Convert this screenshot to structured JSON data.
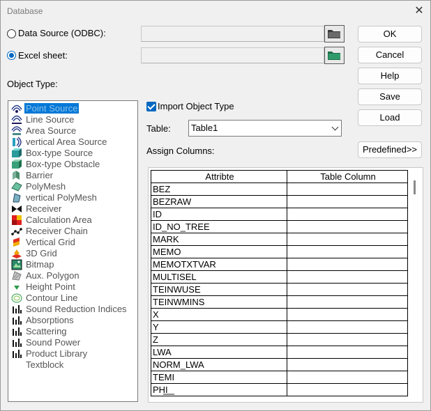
{
  "window": {
    "title": "Database"
  },
  "source": {
    "odbc_label": "Data Source (ODBC):",
    "odbc_selected": false,
    "excel_label": "Excel sheet:",
    "excel_selected": true,
    "odbc_value": "",
    "excel_value": ""
  },
  "object_type_label": "Object Type:",
  "object_types": [
    {
      "label": "Point Source",
      "icon": "point-source-icon",
      "selected": true
    },
    {
      "label": "Line Source",
      "icon": "line-source-icon"
    },
    {
      "label": "Area Source",
      "icon": "area-source-icon"
    },
    {
      "label": "vertical Area Source",
      "icon": "vertical-area-source-icon"
    },
    {
      "label": "Box-type Source",
      "icon": "box-source-icon"
    },
    {
      "label": "Box-type Obstacle",
      "icon": "box-obstacle-icon"
    },
    {
      "label": "Barrier",
      "icon": "barrier-icon"
    },
    {
      "label": "PolyMesh",
      "icon": "polymesh-icon"
    },
    {
      "label": "vertical PolyMesh",
      "icon": "vertical-polymesh-icon"
    },
    {
      "label": "Receiver",
      "icon": "receiver-icon"
    },
    {
      "label": "Calculation Area",
      "icon": "calculation-area-icon"
    },
    {
      "label": "Receiver Chain",
      "icon": "receiver-chain-icon"
    },
    {
      "label": "Vertical Grid",
      "icon": "vertical-grid-icon"
    },
    {
      "label": "3D Grid",
      "icon": "3d-grid-icon"
    },
    {
      "label": "Bitmap",
      "icon": "bitmap-icon"
    },
    {
      "label": "Aux. Polygon",
      "icon": "aux-polygon-icon"
    },
    {
      "label": "Height Point",
      "icon": "height-point-icon"
    },
    {
      "label": "Contour Line",
      "icon": "contour-line-icon"
    },
    {
      "label": "Sound Reduction Indices",
      "icon": "bar-chart-icon"
    },
    {
      "label": "Absorptions",
      "icon": "bar-chart-icon"
    },
    {
      "label": "Scattering",
      "icon": "bar-chart-icon"
    },
    {
      "label": "Sound Power",
      "icon": "bar-chart-icon"
    },
    {
      "label": "Product Library",
      "icon": "bar-chart-icon"
    },
    {
      "label": "Textblock",
      "icon": ""
    }
  ],
  "import_object_type": {
    "label": "Import Object Type",
    "checked": true
  },
  "table": {
    "label": "Table:",
    "value": "Table1"
  },
  "assign_columns_label": "Assign Columns:",
  "buttons": {
    "ok": "OK",
    "cancel": "Cancel",
    "help": "Help",
    "save": "Save",
    "load": "Load",
    "predefined": "Predefined>>"
  },
  "grid": {
    "headers": [
      "Attribte",
      "Table Column"
    ],
    "rows": [
      [
        "BEZ",
        ""
      ],
      [
        "BEZRAW",
        ""
      ],
      [
        "ID",
        ""
      ],
      [
        "ID_NO_TREE",
        ""
      ],
      [
        "MARK",
        ""
      ],
      [
        "MEMO",
        ""
      ],
      [
        "MEMOTXTVAR",
        ""
      ],
      [
        "MULTISEL",
        ""
      ],
      [
        "TEINWUSE",
        ""
      ],
      [
        "TEINWMINS",
        ""
      ],
      [
        "X",
        ""
      ],
      [
        "Y",
        ""
      ],
      [
        "Z",
        ""
      ],
      [
        "LWA",
        ""
      ],
      [
        "NORM_LWA",
        ""
      ],
      [
        "TEMI",
        ""
      ],
      [
        "PHI",
        ""
      ]
    ]
  },
  "colors": {
    "accent": "#0067c0",
    "selection": "#0078d7",
    "folder": "#2f9a6a"
  }
}
